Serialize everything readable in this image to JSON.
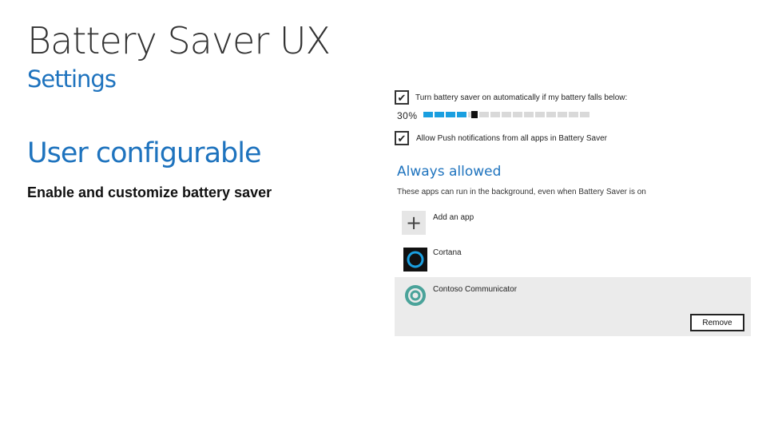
{
  "slide": {
    "title": "Battery Saver UX",
    "subtitle": "Settings",
    "heading": "User configurable",
    "subheading": "Enable and customize battery saver"
  },
  "settings": {
    "auto_on_label": "Turn battery saver on automatically if my battery falls below:",
    "auto_on_checked": true,
    "threshold_value": "30%",
    "threshold_fraction": 0.3,
    "push_label": "Allow Push notifications from all apps in Battery Saver",
    "push_checked": true
  },
  "always_allowed": {
    "title": "Always allowed",
    "description": "These apps can run in the background, even when Battery Saver is on",
    "add_label": "Add an app",
    "apps": [
      {
        "name": "Cortana",
        "icon": "cortana-icon"
      },
      {
        "name": "Contoso Communicator",
        "icon": "contoso-icon"
      }
    ],
    "remove_label": "Remove"
  },
  "colors": {
    "accent": "#1e73be",
    "slider_fill": "#1a9fe0",
    "selected_bg": "#ebebeb"
  }
}
